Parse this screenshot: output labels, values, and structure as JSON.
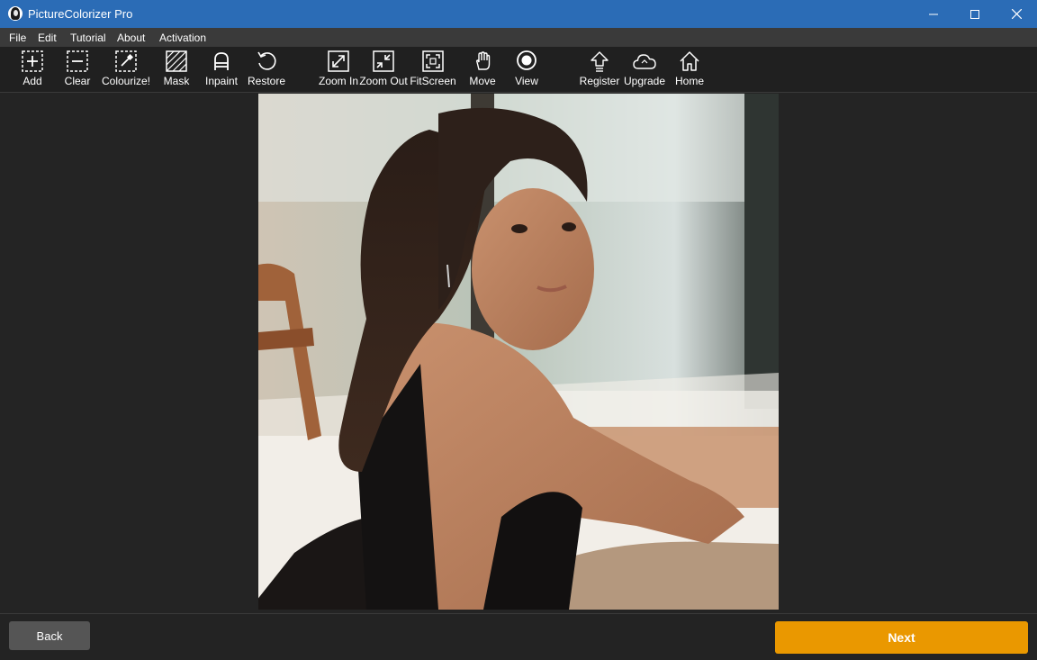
{
  "window": {
    "title": "PictureColorizer Pro",
    "icon": "app-portrait-icon"
  },
  "menu": [
    "File",
    "Edit",
    "Tutorial",
    "About",
    "Activation"
  ],
  "toolbar": {
    "add": "Add",
    "clear": "Clear",
    "colourize": "Colourize!",
    "mask": "Mask",
    "inpaint": "Inpaint",
    "restore": "Restore",
    "zoom_in": "Zoom In",
    "zoom_out": "Zoom Out",
    "fit_screen": "FitScreen",
    "move": "Move",
    "view": "View",
    "register": "Register",
    "upgrade": "Upgrade",
    "home": "Home"
  },
  "footer": {
    "back": "Back",
    "next": "Next"
  },
  "colors": {
    "titlebar": "#2b6cb6",
    "accent": "#ea9800",
    "background": "#232323"
  }
}
